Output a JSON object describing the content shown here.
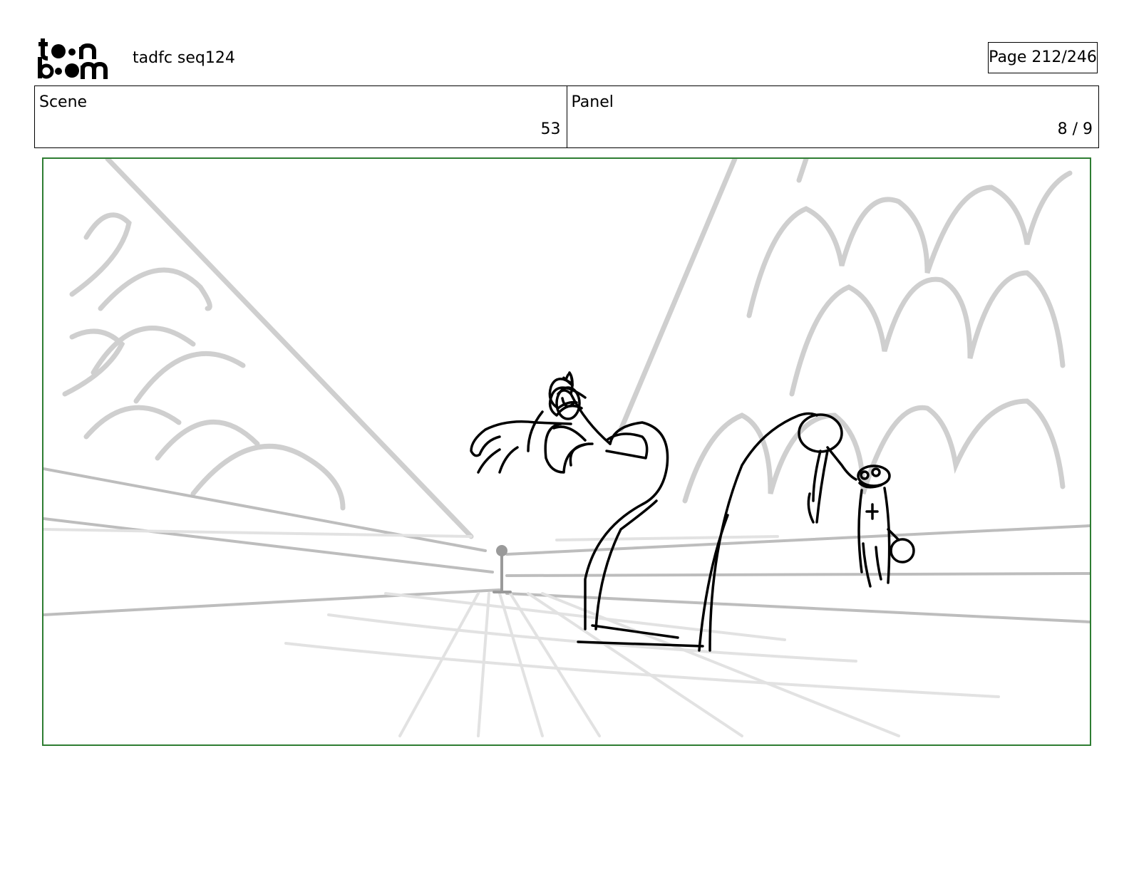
{
  "header": {
    "logo_text": "toon boom",
    "project_title": "tadfc seq124",
    "page_label": "Page 212/246"
  },
  "info": {
    "scene_label": "Scene",
    "scene_value": "53",
    "panel_label": "Panel",
    "panel_value": "8 / 9"
  },
  "colors": {
    "panel_border": "#2e7d32",
    "sketch_grey": "#c8c8c8",
    "ink": "#000000"
  }
}
